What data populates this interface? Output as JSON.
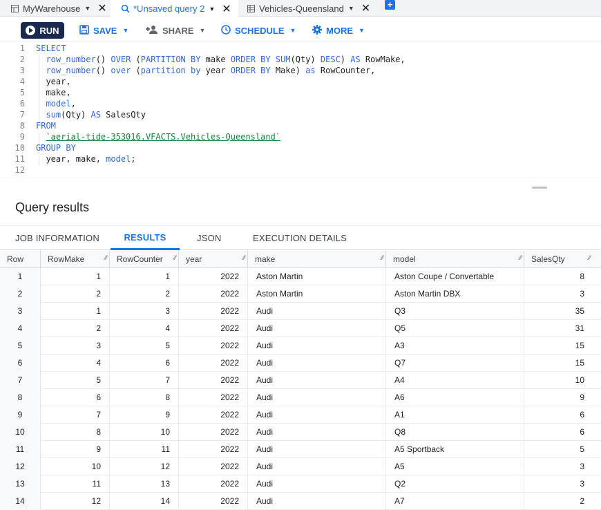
{
  "tabs": [
    {
      "label": "MyWarehouse",
      "icon": "dataset-icon"
    },
    {
      "label": "*Unsaved query 2",
      "icon": "query-icon"
    },
    {
      "label": "Vehicles-Queensland",
      "icon": "table-icon"
    }
  ],
  "toolbar": {
    "run": "RUN",
    "save": "SAVE",
    "share": "SHARE",
    "schedule": "SCHEDULE",
    "more": "MORE"
  },
  "editor": {
    "line_numbers": [
      "1",
      "2",
      "3",
      "4",
      "5",
      "6",
      "7",
      "8",
      "9",
      "10",
      "11",
      "12"
    ]
  },
  "results_title": "Query results",
  "result_tabs": [
    "JOB INFORMATION",
    "RESULTS",
    "JSON",
    "EXECUTION DETAILS"
  ],
  "table": {
    "columns": [
      "Row",
      "RowMake",
      "RowCounter",
      "year",
      "make",
      "model",
      "SalesQty"
    ],
    "rows": [
      [
        "1",
        "1",
        "1",
        "2022",
        "Aston Martin",
        "Aston Coupe / Convertable",
        "8"
      ],
      [
        "2",
        "2",
        "2",
        "2022",
        "Aston Martin",
        "Aston Martin DBX",
        "3"
      ],
      [
        "3",
        "1",
        "3",
        "2022",
        "Audi",
        "Q3",
        "35"
      ],
      [
        "4",
        "2",
        "4",
        "2022",
        "Audi",
        "Q5",
        "31"
      ],
      [
        "5",
        "3",
        "5",
        "2022",
        "Audi",
        "A3",
        "15"
      ],
      [
        "6",
        "4",
        "6",
        "2022",
        "Audi",
        "Q7",
        "15"
      ],
      [
        "7",
        "5",
        "7",
        "2022",
        "Audi",
        "A4",
        "10"
      ],
      [
        "8",
        "6",
        "8",
        "2022",
        "Audi",
        "A6",
        "9"
      ],
      [
        "9",
        "7",
        "9",
        "2022",
        "Audi",
        "A1",
        "6"
      ],
      [
        "10",
        "8",
        "10",
        "2022",
        "Audi",
        "Q8",
        "6"
      ],
      [
        "11",
        "9",
        "11",
        "2022",
        "Audi",
        "A5 Sportback",
        "5"
      ],
      [
        "12",
        "10",
        "12",
        "2022",
        "Audi",
        "A5",
        "3"
      ],
      [
        "13",
        "11",
        "13",
        "2022",
        "Audi",
        "Q2",
        "3"
      ],
      [
        "14",
        "12",
        "14",
        "2022",
        "Audi",
        "A7",
        "2"
      ]
    ]
  },
  "colors": {
    "accent": "#1a73e8",
    "run_bg": "#1a2a4f",
    "keyword": "#3367d6",
    "string": "#188038"
  }
}
